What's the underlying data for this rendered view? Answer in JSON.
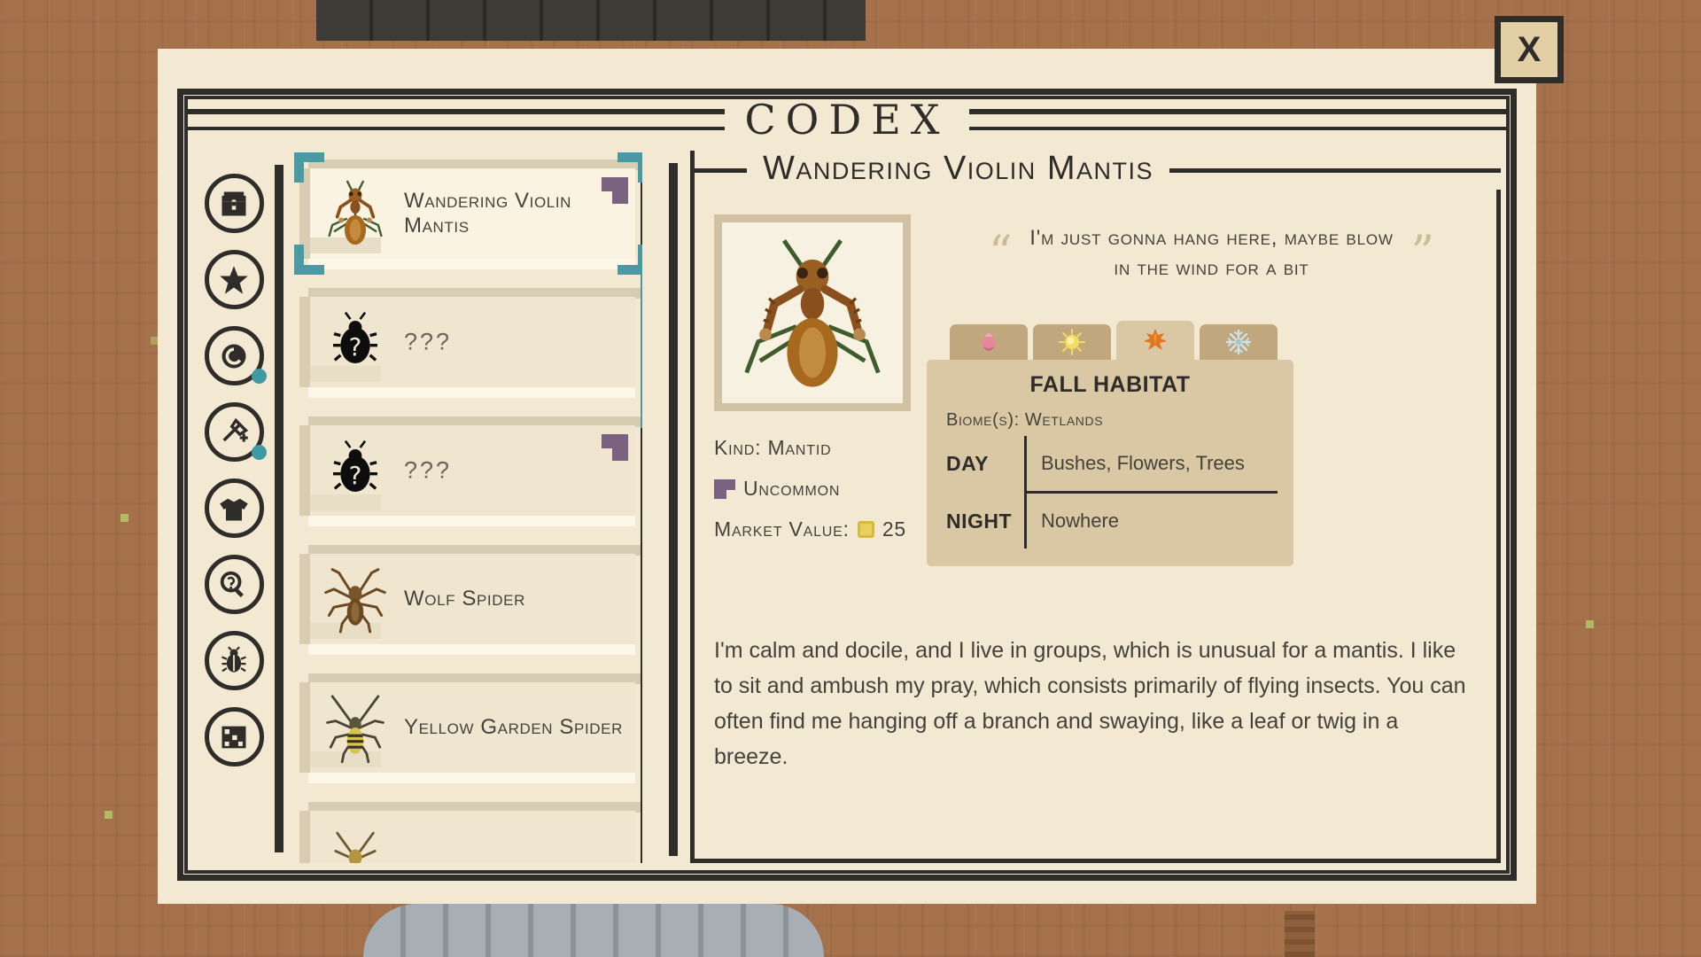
{
  "window": {
    "title": "CODEX",
    "close_label": "X"
  },
  "sidebar": {
    "items": [
      {
        "name": "collection",
        "icon": "chest-icon",
        "badge": false
      },
      {
        "name": "favorites",
        "icon": "star-icon",
        "badge": false
      },
      {
        "name": "currency",
        "icon": "coin-icon",
        "badge": true
      },
      {
        "name": "tools",
        "icon": "net-tool-icon",
        "badge": true
      },
      {
        "name": "apparel",
        "icon": "shirt-icon",
        "badge": false
      },
      {
        "name": "research",
        "icon": "magnifier-icon",
        "badge": false
      },
      {
        "name": "bugs",
        "icon": "beetle-icon",
        "badge": false
      },
      {
        "name": "map",
        "icon": "map-icon",
        "badge": false
      }
    ]
  },
  "list": {
    "items": [
      {
        "label": "Wandering Violin Mantis",
        "sprite": "mantis",
        "selected": true,
        "rarity_tag": true
      },
      {
        "label": "???",
        "sprite": "unknown",
        "selected": false,
        "rarity_tag": false
      },
      {
        "label": "???",
        "sprite": "unknown",
        "selected": false,
        "rarity_tag": true
      },
      {
        "label": "Wolf Spider",
        "sprite": "wolf-spider",
        "selected": false,
        "rarity_tag": false
      },
      {
        "label": "Yellow Garden Spider",
        "sprite": "garden-spider",
        "selected": false,
        "rarity_tag": false
      },
      {
        "label": "",
        "sprite": "partial",
        "selected": false,
        "rarity_tag": false
      }
    ],
    "scroll_thumb_top_pct": 12,
    "scroll_thumb_height_pct": 26
  },
  "detail": {
    "title": "Wandering Violin Mantis",
    "quote": "I'm just gonna hang here, maybe blow in the wind for a bit",
    "quote_open": "“",
    "quote_close": "”",
    "kind_line": "Kind: Mantid",
    "rarity": "Uncommon",
    "market_label": "Market Value:",
    "market_value": "25",
    "description": "I'm calm and docile, and I live in groups, which is unusual for a mantis. I like to sit and ambush my pray, which consists primarily of flying insects. You can often find me hanging off a branch and swaying, like a leaf or twig in a breeze."
  },
  "habitat": {
    "seasons": [
      {
        "name": "spring",
        "icon": "flower-icon",
        "active": false
      },
      {
        "name": "summer",
        "icon": "sun-icon",
        "active": false
      },
      {
        "name": "fall",
        "icon": "leaf-icon",
        "active": true
      },
      {
        "name": "winter",
        "icon": "snowflake-icon",
        "active": false
      }
    ],
    "heading": "FALL HABITAT",
    "biome_line": "Biome(s): Wetlands",
    "rows": [
      {
        "key": "DAY",
        "value": "Bushes, Flowers, Trees"
      },
      {
        "key": "NIGHT",
        "value": "Nowhere"
      }
    ]
  },
  "colors": {
    "paper": "#f3e8d2",
    "ink": "#2e2d29",
    "teal_accent": "#4a9aa3",
    "rarity_purple": "#7a6180",
    "card_tan": "#d9c8a3",
    "background_dirt": "#a5714a",
    "coin_gold": "#e8cf5e"
  }
}
